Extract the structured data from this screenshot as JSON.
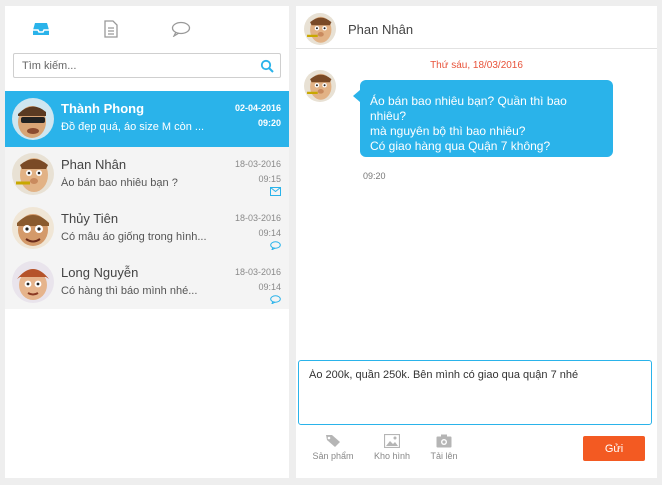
{
  "sidebar": {
    "tabs": [
      {
        "icon": "inbox-icon",
        "active": true
      },
      {
        "icon": "document-icon",
        "active": false
      },
      {
        "icon": "chat-bubble-icon",
        "active": false
      }
    ],
    "search_placeholder": "Tìm kiếm...",
    "conversations": [
      {
        "name": "Thành Phong",
        "preview": "Đồ đẹp quá, áo size M còn ...",
        "date": "02-04-2016",
        "time": "09:20",
        "active": true
      },
      {
        "name": "Phan Nhân",
        "preview": "Áo bán bao nhiêu bạn ?",
        "date": "18-03-2016",
        "time": "09:15",
        "icon": "mail-icon"
      },
      {
        "name": "Thủy Tiên",
        "preview": "Có mẫu áo giống trong hình...",
        "date": "18-03-2016",
        "time": "09:14",
        "icon": "chat-bubble-icon"
      },
      {
        "name": "Long Nguyễn",
        "preview": "Có hàng thì báo mình nhé...",
        "date": "18-03-2016",
        "time": "09:14",
        "icon": "chat-bubble-icon"
      }
    ]
  },
  "chat": {
    "contact_name": "Phan Nhân",
    "date_separator": "Thứ sáu, 18/03/2016",
    "message_lines": [
      "Áo bán bao nhiêu bạn? Quần thì bao nhiêu?",
      "mà nguyên bộ thì bao nhiêu?",
      "Có giao hàng qua Quận 7 không?"
    ],
    "message_time": "09:20",
    "compose_value": "Áo 200k, quần 250k. Bên mình có giao qua quận 7 nhé",
    "tools": [
      {
        "label": "Sản phẩm",
        "icon": "tag-icon"
      },
      {
        "label": "Kho hình",
        "icon": "image-icon"
      },
      {
        "label": "Tải lên",
        "icon": "camera-icon"
      }
    ],
    "send_label": "Gửi"
  },
  "colors": {
    "accent_blue": "#2ab3ea",
    "send_orange": "#f35a22",
    "date_red": "#e8533a"
  }
}
